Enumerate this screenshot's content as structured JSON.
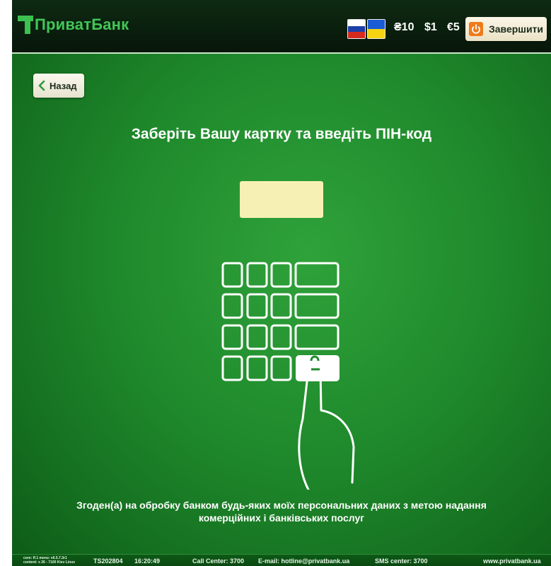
{
  "app": {
    "logo_text": "ПриватБанк"
  },
  "header": {
    "currencies": [
      "₴10",
      "$1",
      "€5"
    ],
    "finish_label": "Завершити"
  },
  "nav": {
    "back_label": "Назад"
  },
  "main": {
    "heading": "Заберіть Вашу картку та введіть ПІН-код",
    "consent_line1": "Згоден(а) на обробку банком будь-яких моїх персональних даних з метою надання",
    "consent_line2": "комерційних і банківських послуг"
  },
  "footer": {
    "sysinfo_line1": "core: ff.1  menu: v6.5.7.3r1",
    "sysinfo_line2": "content: x 26 - 7100  Kiev  Linux",
    "terminal_id": "TS202804",
    "time": "16:20:49",
    "call_center": "Call Center: 3700",
    "email": "E-mail: hotline@privatbank.ua",
    "sms_center": "SMS center: 3700",
    "website": "www.privatbank.ua"
  },
  "colors": {
    "brand_green": "#43c558",
    "screen_green": "#1f8a2c",
    "pin_field": "#f6f0b4",
    "power_icon": "#f07a1a"
  },
  "icons": {
    "logo": "privatbank-logo-icon",
    "ru_flag": "russian-flag-icon",
    "ua_flag": "ukrainian-flag-icon",
    "power": "power-icon",
    "back": "chevron-left-icon",
    "keypad": "keypad-hand-illustration"
  }
}
